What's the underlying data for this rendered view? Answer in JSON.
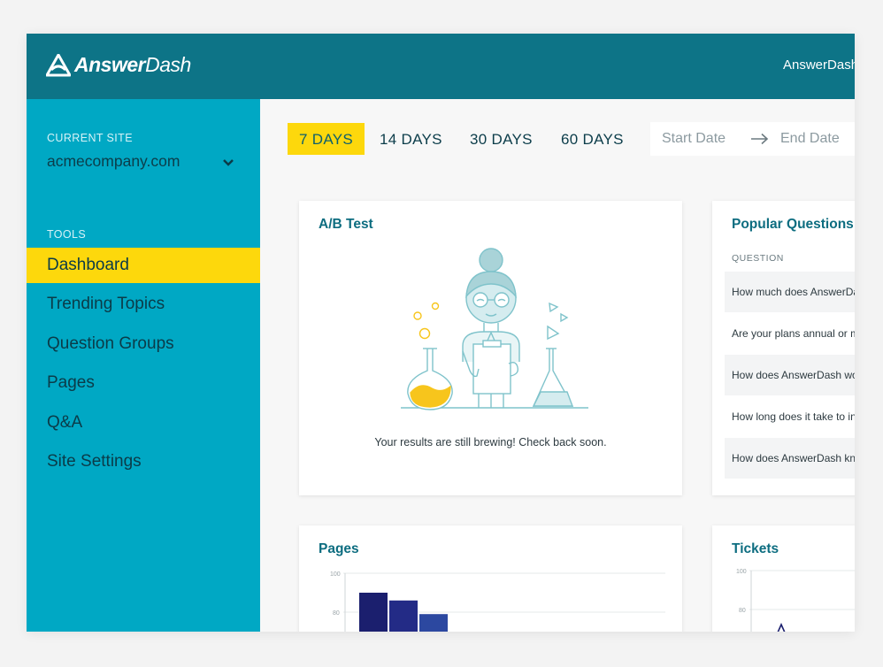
{
  "brand": {
    "name_bold": "Answer",
    "name_light": "Dash"
  },
  "header": {
    "user_name": "AnswerDash"
  },
  "sidebar": {
    "current_site_caption": "CURRENT SITE",
    "current_site": "acmecompany.com",
    "tools_caption": "TOOLS",
    "items": [
      {
        "label": "Dashboard",
        "active": true
      },
      {
        "label": "Trending Topics"
      },
      {
        "label": "Question Groups"
      },
      {
        "label": "Pages"
      },
      {
        "label": "Q&A"
      },
      {
        "label": "Site Settings"
      }
    ]
  },
  "filters": {
    "ranges": [
      "7 DAYS",
      "14 DAYS",
      "30 DAYS",
      "60 DAYS"
    ],
    "selected": "7 DAYS",
    "start_placeholder": "Start Date",
    "end_placeholder": "End Date"
  },
  "ab_test": {
    "title": "A/B Test",
    "message": "Your results are still brewing! Check back soon."
  },
  "popular_questions": {
    "title": "Popular Questions",
    "column": "QUESTION",
    "rows": [
      "How much does AnswerDash cost?",
      "Are your plans annual or monthly?",
      "How does AnswerDash work?",
      "How long does it take to install?",
      "How does AnswerDash know?"
    ]
  },
  "pages_card": {
    "title": "Pages"
  },
  "tickets_card": {
    "title": "Tickets"
  },
  "chart_data": [
    {
      "type": "bar",
      "title": "Pages",
      "ylim": [
        0,
        100
      ],
      "yticks": [
        "100",
        "80"
      ],
      "values": [
        90,
        86,
        79
      ],
      "colors": [
        "#1b1f6e",
        "#232b86",
        "#2c48a0"
      ]
    },
    {
      "type": "line",
      "title": "Tickets",
      "ylim": [
        0,
        100
      ],
      "yticks": [
        "100",
        "80"
      ]
    }
  ],
  "colors": {
    "header": "#0d7487",
    "sidebar": "#00a8c4",
    "accent": "#fdd80c"
  }
}
